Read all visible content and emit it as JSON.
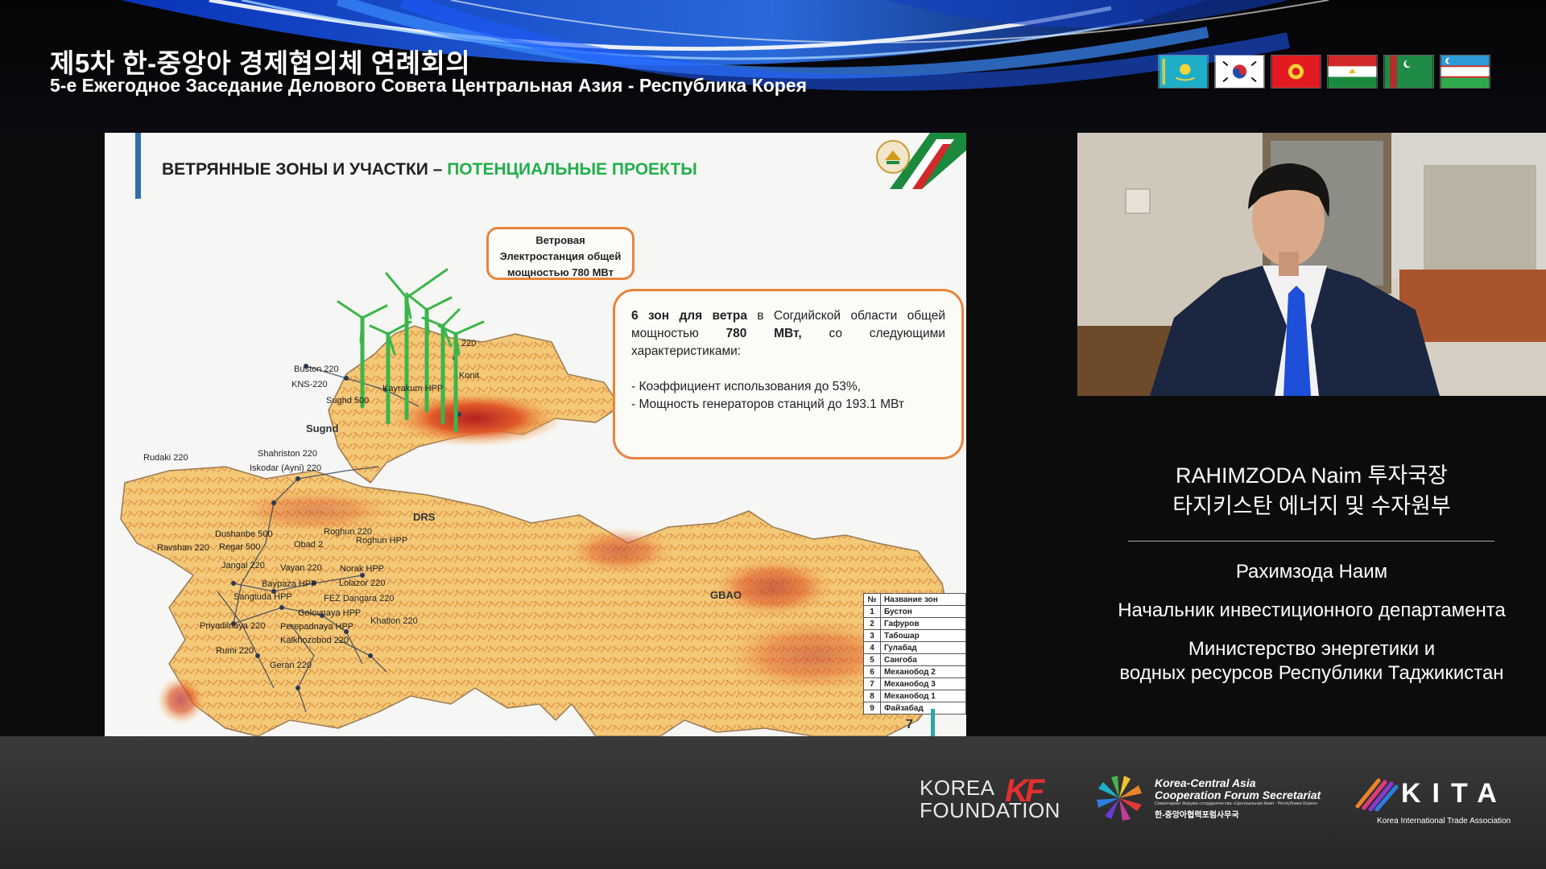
{
  "header": {
    "title_korean": "제5차 한-중앙아 경제협의체 연례회의",
    "title_russian": "5-е Ежегодное Заседание Делового Совета Центральная Азия - Республика Корея",
    "flags": [
      "kazakhstan-flag",
      "south-korea-flag",
      "kyrgyzstan-flag",
      "tajikistan-flag",
      "turkmenistan-flag",
      "uzbekistan-flag"
    ]
  },
  "slide": {
    "title_part1": "ВЕТРЯННЫЕ ЗОНЫ И УЧАСТКИ – ",
    "title_part2": "ПОТЕНЦИАЛЬНЫЕ ПРОЕКТЫ",
    "callout_small": [
      "Ветровая",
      "Электростанция общей",
      "мощностью 780 МВт"
    ],
    "callout_main": {
      "bold_intro": "6 зон для ветра",
      "text1": " в Согдийской области общей мощностью ",
      "bold_value": "780 МВт,",
      "text2": " со следующими характеристиками:",
      "bullet1": "- Коэффициент использования до 53%,",
      "bullet2": "- Мощность генераторов станций до 193.1 МВт"
    },
    "map_regions": [
      "Sugnd",
      "DRS",
      "GBAO"
    ],
    "map_labels": [
      "Buston 220",
      "KNS-220",
      "Sughd 500",
      "Kayrakum HPP",
      "Konit",
      "220",
      "Rudaki 220",
      "Shahriston 220",
      "Iskodar (Ayni) 220",
      "Dushanbe 500",
      "Roghun 220",
      "Roghun HPP",
      "Ravshan 220",
      "Regar 500",
      "Obad 2",
      "Jangal 220",
      "Vayan 220",
      "Norak HPP",
      "Baypaza HPP",
      "Sangtuda HPP",
      "FEZ Dangara 220",
      "Lolazor 220",
      "Golovnaya HPP",
      "Perepadnaya HPP",
      "Priyadilnaya 220",
      "Kalkhozobod 220",
      "Khatlon 220",
      "Rumi 220",
      "Geran 220"
    ],
    "zone_table": {
      "header_num": "№",
      "header_name": "Название зон",
      "rows": [
        {
          "n": "1",
          "name": "Бустон"
        },
        {
          "n": "2",
          "name": "Гафуров"
        },
        {
          "n": "3",
          "name": "Табошар"
        },
        {
          "n": "4",
          "name": "Гулабад"
        },
        {
          "n": "5",
          "name": "Сангоба"
        },
        {
          "n": "6",
          "name": "Механобод 2"
        },
        {
          "n": "7",
          "name": "Механобод 3"
        },
        {
          "n": "8",
          "name": "Механобод 1"
        },
        {
          "n": "9",
          "name": "Файзабад"
        }
      ]
    },
    "page_number": "7"
  },
  "speaker": {
    "name_korean": "RAHIMZODA Naim 투자국장",
    "org_korean": "타지키스탄 에너지 및 수자원부",
    "name_russian": "Рахимзода Наим",
    "position_russian": "Начальник инвестиционного департамента",
    "org_russian_line1": "Министерство энергетики и",
    "org_russian_line2": "водных ресурсов Республики Таджикистан"
  },
  "footer": {
    "kf_line1": "KOREA",
    "kf_line2": "FOUNDATION",
    "kf_mark": "KF",
    "kca_line1": "Korea-Central Asia",
    "kca_line2": "Cooperation Forum Secretariat",
    "kca_line3": "Секретариат Форума сотрудничества «Центральная Азия - Республика Корея»",
    "kca_line4": "한-중앙아협력포럼사무국",
    "kita_name": "KITA",
    "kita_sub": "Korea International Trade Association"
  }
}
